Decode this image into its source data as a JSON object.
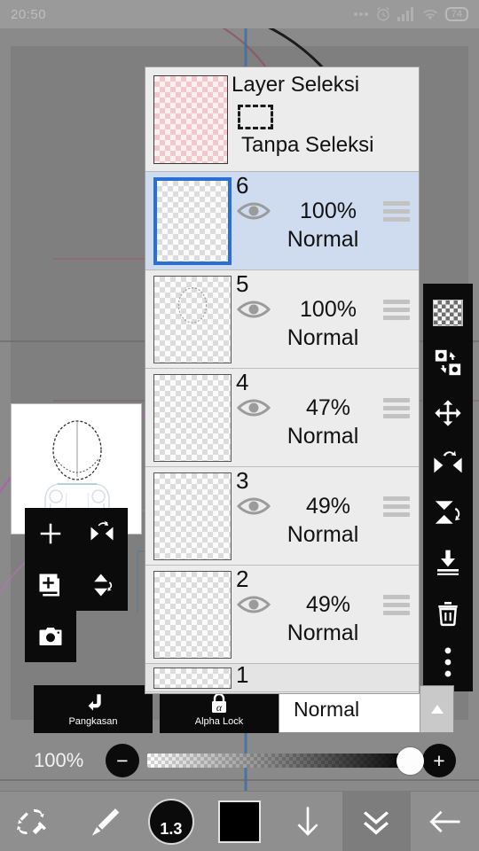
{
  "statusbar": {
    "time": "20:50",
    "battery": "74",
    "icons": [
      "more-dots-icon",
      "alarm-clock-icon",
      "signal-bars-icon",
      "wifi-icon",
      "battery-icon"
    ]
  },
  "layer_panel": {
    "selection_header": {
      "title": "Layer Seleksi",
      "subtitle": "Tanpa Seleksi",
      "thumbnail_color": "#f3c8cc"
    },
    "layers": [
      {
        "num": "6",
        "opacity": "100%",
        "mode": "Normal",
        "selected": true,
        "visible": true,
        "partial": false
      },
      {
        "num": "5",
        "opacity": "100%",
        "mode": "Normal",
        "selected": false,
        "visible": true,
        "partial": false
      },
      {
        "num": "4",
        "opacity": "47%",
        "mode": "Normal",
        "selected": false,
        "visible": true,
        "partial": false
      },
      {
        "num": "3",
        "opacity": "49%",
        "mode": "Normal",
        "selected": false,
        "visible": true,
        "partial": false
      },
      {
        "num": "2",
        "opacity": "49%",
        "mode": "Normal",
        "selected": false,
        "visible": true,
        "partial": false
      },
      {
        "num": "1",
        "opacity": "",
        "mode": "",
        "selected": false,
        "visible": true,
        "partial": true
      }
    ],
    "selected_accent": "#2a6fd6",
    "selected_row_bg": "#cfdcef"
  },
  "left_tools": [
    {
      "name": "add-layer-button",
      "icon": "plus-icon"
    },
    {
      "name": "flip-horizontal-button",
      "icon": "flip-horizontal-icon"
    },
    {
      "name": "duplicate-layer-button",
      "icon": "duplicate-layer-icon"
    },
    {
      "name": "flip-vertical-button",
      "icon": "flip-vertical-icon"
    },
    {
      "name": "camera-button",
      "icon": "camera-icon"
    }
  ],
  "right_tools": [
    {
      "name": "transparency-button",
      "icon": "checkerboard-icon"
    },
    {
      "name": "swap-layer-button",
      "icon": "swap-layers-icon"
    },
    {
      "name": "move-button",
      "icon": "move-arrows-icon"
    },
    {
      "name": "flip-horizontal-button",
      "icon": "flip-horizontal-icon"
    },
    {
      "name": "flip-vertical-button",
      "icon": "flip-vertical-icon"
    },
    {
      "name": "merge-down-button",
      "icon": "merge-down-icon"
    },
    {
      "name": "delete-layer-button",
      "icon": "trash-icon"
    },
    {
      "name": "more-options-button",
      "icon": "more-vertical-icon"
    }
  ],
  "bottom_controls": {
    "clip_label": "Pangkasan",
    "clip_icon": "clipping-arrow-icon",
    "alpha_lock_label": "Alpha Lock",
    "alpha_lock_icon": "alpha-lock-icon",
    "blend_mode": "Normal",
    "blend_arrow_icon": "triangle-up-icon",
    "opacity_value": "100%",
    "minus_label": "−",
    "plus_label": "+"
  },
  "bottom_nav": [
    {
      "name": "brush-eraser-swap-button",
      "icon": "brush-eraser-swap-icon"
    },
    {
      "name": "brush-tool-button",
      "icon": "brush-icon"
    },
    {
      "name": "brush-size-button",
      "icon": "brush-size-icon",
      "value": "1.3"
    },
    {
      "name": "color-swatch-button",
      "icon": "color-swatch-icon",
      "color": "#000000"
    },
    {
      "name": "download-button",
      "icon": "arrow-down-icon"
    },
    {
      "name": "collapse-panel-button",
      "icon": "double-chevron-down-icon",
      "active": true
    },
    {
      "name": "back-button",
      "icon": "arrow-left-icon"
    }
  ]
}
